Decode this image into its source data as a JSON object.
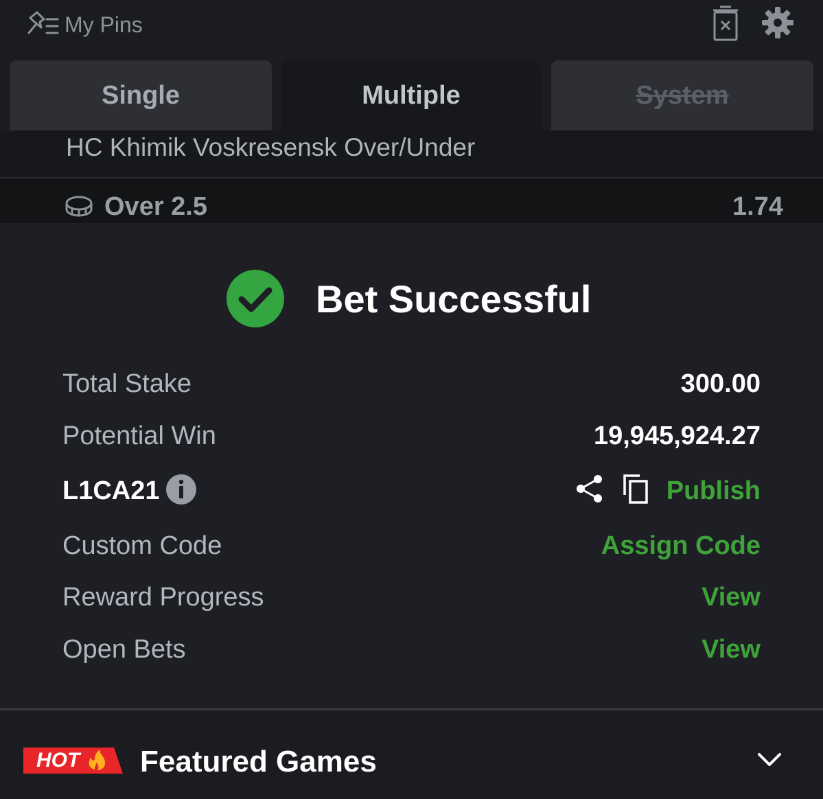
{
  "header": {
    "pins_label": "My Pins"
  },
  "tabs": [
    {
      "label": "Single"
    },
    {
      "label": "Multiple"
    },
    {
      "label": "System"
    }
  ],
  "market": {
    "title": "HC Khimik Voskresensk Over/Under"
  },
  "selection": {
    "label": "Over 2.5",
    "odds": "1.74"
  },
  "status": {
    "title": "Bet Successful"
  },
  "details": {
    "total_stake_label": "Total Stake",
    "total_stake_value": "300.00",
    "potential_win_label": "Potential Win",
    "potential_win_value": "19,945,924.27",
    "booking_code": "L1CA21",
    "publish_label": "Publish",
    "custom_code_label": "Custom Code",
    "assign_code_label": "Assign Code",
    "reward_progress_label": "Reward Progress",
    "reward_view_label": "View",
    "open_bets_label": "Open Bets",
    "open_bets_view_label": "View"
  },
  "featured": {
    "badge": "HOT",
    "title": "Featured Games"
  },
  "colors": {
    "accent_green": "#3fa33a",
    "hot_red": "#e8262a",
    "check_green": "#34a540"
  }
}
